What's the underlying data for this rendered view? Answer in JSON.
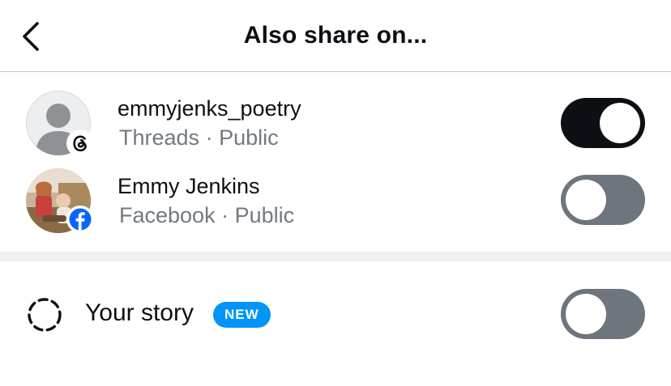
{
  "header": {
    "title": "Also share on...",
    "back_icon": "chevron-left-icon"
  },
  "accounts": [
    {
      "name": "emmyjenks_poetry",
      "platform": "Threads",
      "separator": "·",
      "audience": "Public",
      "avatar_icon": "default-avatar-icon",
      "badge_icon": "threads-logo-icon",
      "toggle_on": true
    },
    {
      "name": "Emmy Jenkins",
      "platform": "Facebook",
      "separator": "·",
      "audience": "Public",
      "avatar_icon": "profile-photo",
      "badge_icon": "facebook-logo-icon",
      "toggle_on": false
    }
  ],
  "story": {
    "label": "Your story",
    "badge": "NEW",
    "icon": "dashed-circle-story-icon",
    "toggle_on": false
  },
  "colors": {
    "toggle_on": "#0c1014",
    "toggle_off": "#6f757c",
    "new_badge": "#0095f6",
    "facebook_blue": "#0866ff",
    "secondary_text": "#737980"
  }
}
